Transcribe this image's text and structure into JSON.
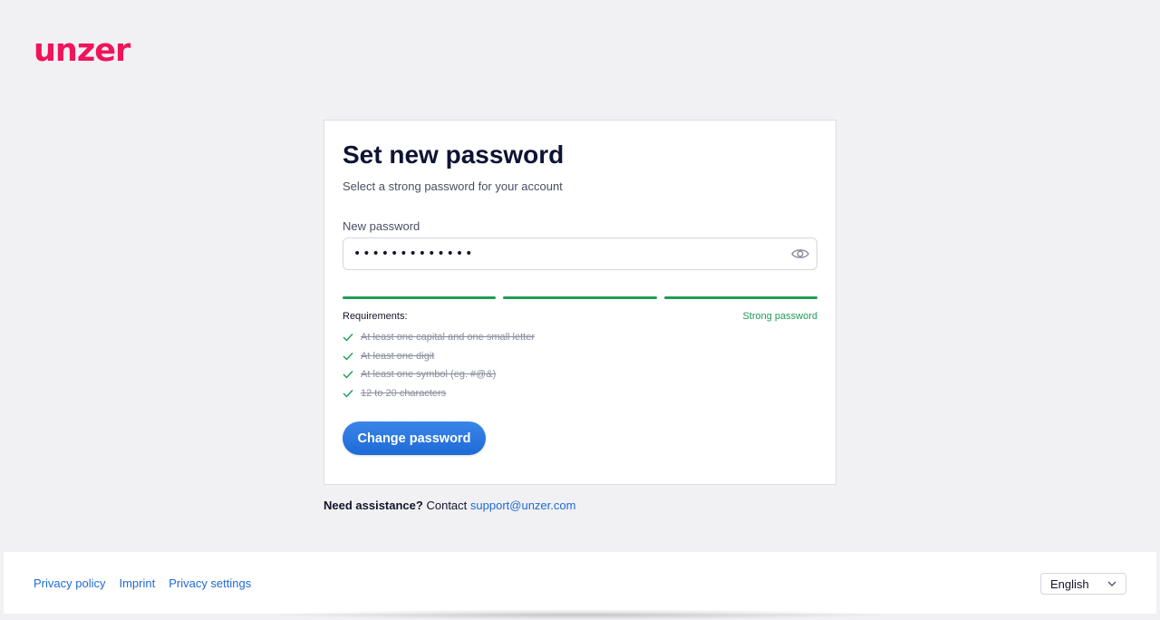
{
  "brand": {
    "logo_text": "unzer",
    "color": "#f0145a"
  },
  "card": {
    "title": "Set new password",
    "subtitle": "Select a strong password for your account",
    "password_label": "New password",
    "password_value": "•••••••••••••",
    "show_password_icon": "eye-icon",
    "strength": {
      "segments_filled": 3,
      "segments_total": 3,
      "label": "Strong password",
      "color": "#1f9d55"
    },
    "requirements_label": "Requirements:",
    "requirements": [
      {
        "text": "At least one capital and one small letter",
        "met": true
      },
      {
        "text": "At least one digit",
        "met": true
      },
      {
        "text": "At least one symbol (eg. #@&)",
        "met": true
      },
      {
        "text": "12 to 20 characters",
        "met": true
      }
    ],
    "submit_label": "Change password"
  },
  "assistance": {
    "prefix": "Need assistance?",
    "middle": "Contact",
    "email": "support@unzer.com"
  },
  "footer": {
    "links": [
      "Privacy policy",
      "Imprint",
      "Privacy settings"
    ],
    "language": "English"
  },
  "colors": {
    "accent": "#1e6ad6",
    "background": "#f1f1f4"
  }
}
